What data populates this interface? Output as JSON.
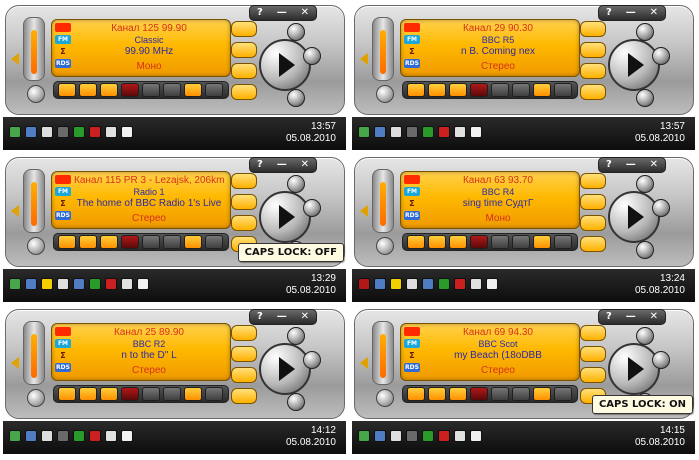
{
  "window_controls": [
    "?",
    "—",
    "✕"
  ],
  "panels": [
    {
      "channel": "Канал 125 99.90",
      "station": "Classic",
      "info": "99.90 MHz",
      "mode": "Моно",
      "time": "13:57",
      "date": "05.08.2010",
      "caps_lock": ""
    },
    {
      "channel": "Канал 29 90.30",
      "station": "BBC R5",
      "info": "n B. Coming nex",
      "mode": "Стерео",
      "time": "13:57",
      "date": "05.08.2010",
      "caps_lock": ""
    },
    {
      "channel": "Канал 115 PR 3 - Lezajsk, 206km",
      "station": "Radio 1",
      "info": "The home of BBC Radio 1's Live",
      "mode": "Стерео",
      "time": "13:29",
      "date": "05.08.2010",
      "caps_lock": "CAPS LOCK: OFF"
    },
    {
      "channel": "Канал 63 93.70",
      "station": "BBC R4",
      "info": "sing   time                      СудтГ",
      "mode": "Моно",
      "time": "13:24",
      "date": "05.08.2010",
      "caps_lock": ""
    },
    {
      "channel": "Канал 25 89.90",
      "station": "BBC R2",
      "info": "n to the              D\" L",
      "mode": "Стерео",
      "time": "14:12",
      "date": "05.08.2010",
      "caps_lock": ""
    },
    {
      "channel": "Канал 69 94.30",
      "station": "BBC Scot",
      "info": "my Beach (18oDBB",
      "mode": "Стерео",
      "time": "14:15",
      "date": "05.08.2010",
      "caps_lock": "CAPS LOCK: ON"
    }
  ],
  "display_icons": {
    "eye": "eye-icon",
    "fm": "FM",
    "signal": "Σ",
    "rds": "RDS"
  },
  "colors": {
    "display_orange": "#ffb800",
    "display_red_text": "#d6321a",
    "display_blue_text": "#2a2aa7",
    "taskbar_dark": "#0d0d0d"
  },
  "tray_icons": [
    "shield-icon",
    "network-icon",
    "battery-icon",
    "music-icon",
    "wifi-icon",
    "signal-icon",
    "flag-icon",
    "volume-icon"
  ]
}
